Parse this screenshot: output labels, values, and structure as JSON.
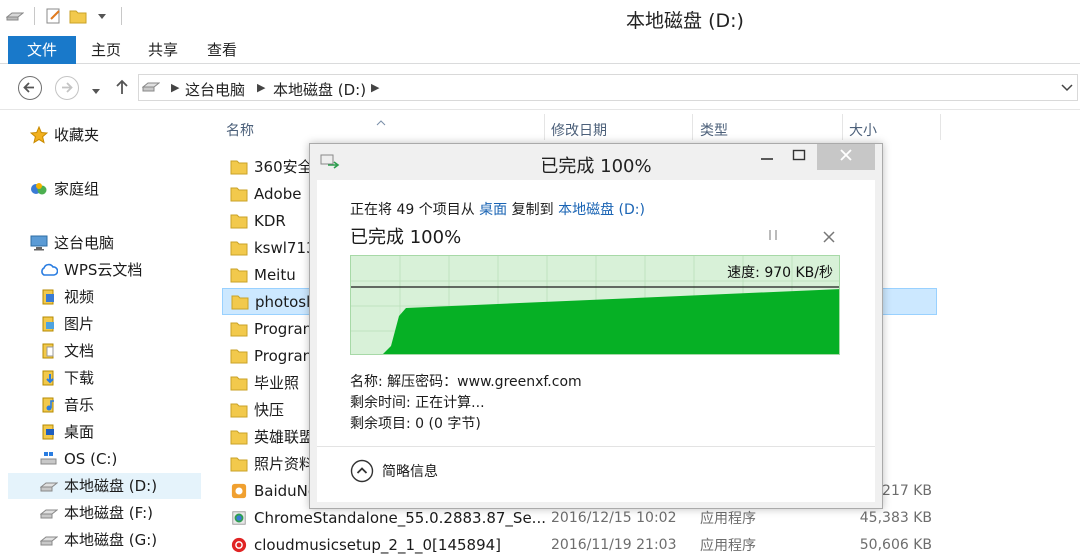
{
  "window": {
    "title": "本地磁盘 (D:)"
  },
  "ribbon": {
    "tabs": [
      "文件",
      "主页",
      "共享",
      "查看"
    ]
  },
  "address": {
    "crumbs": [
      "这台电脑",
      "本地磁盘 (D:)"
    ]
  },
  "sidebar": {
    "favorites": "收藏夹",
    "homegroup": "家庭组",
    "this_pc": "这台电脑",
    "items": [
      "WPS云文档",
      "视频",
      "图片",
      "文档",
      "下载",
      "音乐",
      "桌面",
      "OS (C:)",
      "本地磁盘 (D:)",
      "本地磁盘 (F:)",
      "本地磁盘 (G:)"
    ]
  },
  "columns": {
    "name": "名称",
    "date": "修改日期",
    "type": "类型",
    "size": "大小"
  },
  "files": [
    {
      "name": "360安全",
      "date": "",
      "type": "",
      "size": ""
    },
    {
      "name": "Adobe",
      "date": "",
      "type": "",
      "size": ""
    },
    {
      "name": "KDR",
      "date": "",
      "type": "",
      "size": ""
    },
    {
      "name": "kswl713",
      "date": "",
      "type": "",
      "size": ""
    },
    {
      "name": "Meitu",
      "date": "",
      "type": "",
      "size": ""
    },
    {
      "name": "photosl",
      "date": "",
      "type": "",
      "size": ""
    },
    {
      "name": "Progran",
      "date": "",
      "type": "",
      "size": ""
    },
    {
      "name": "Progran",
      "date": "",
      "type": "",
      "size": ""
    },
    {
      "name": "毕业照",
      "date": "",
      "type": "",
      "size": ""
    },
    {
      "name": "快压",
      "date": "",
      "type": "",
      "size": ""
    },
    {
      "name": "英雄联盟",
      "date": "",
      "type": "",
      "size": ""
    },
    {
      "name": "照片资料",
      "date": "",
      "type": "",
      "size": ""
    },
    {
      "name": "BaiduNe",
      "date": "",
      "type": "",
      "size": "217 KB"
    },
    {
      "name": "ChromeStandalone_55.0.2883.87_Se...",
      "date": "2016/12/15 10:02",
      "type": "应用程序",
      "size": "45,383 KB"
    },
    {
      "name": "cloudmusicsetup_2_1_0[145894]",
      "date": "2016/11/19 21:03",
      "type": "应用程序",
      "size": "50,606 KB"
    }
  ],
  "dialog": {
    "title": "已完成 100%",
    "copy_prefix": "正在将 49 个项目从",
    "from": "桌面",
    "copy_mid": "复制到",
    "to": "本地磁盘 (D:)",
    "status": "已完成 100%",
    "speed": "速度: 970 KB/秒",
    "speed_kbps": 970,
    "progress_percent": 100,
    "name_line": "名称: 解压密码：www.greenxf.com",
    "time_line": "剩余时间: 正在计算...",
    "items_line": "剩余项目: 0 (0 字节)",
    "less_info": "简略信息"
  },
  "colors": {
    "accent": "#1979ca",
    "graph_fill": "#06b025",
    "graph_bg": "#d8f1d8"
  }
}
